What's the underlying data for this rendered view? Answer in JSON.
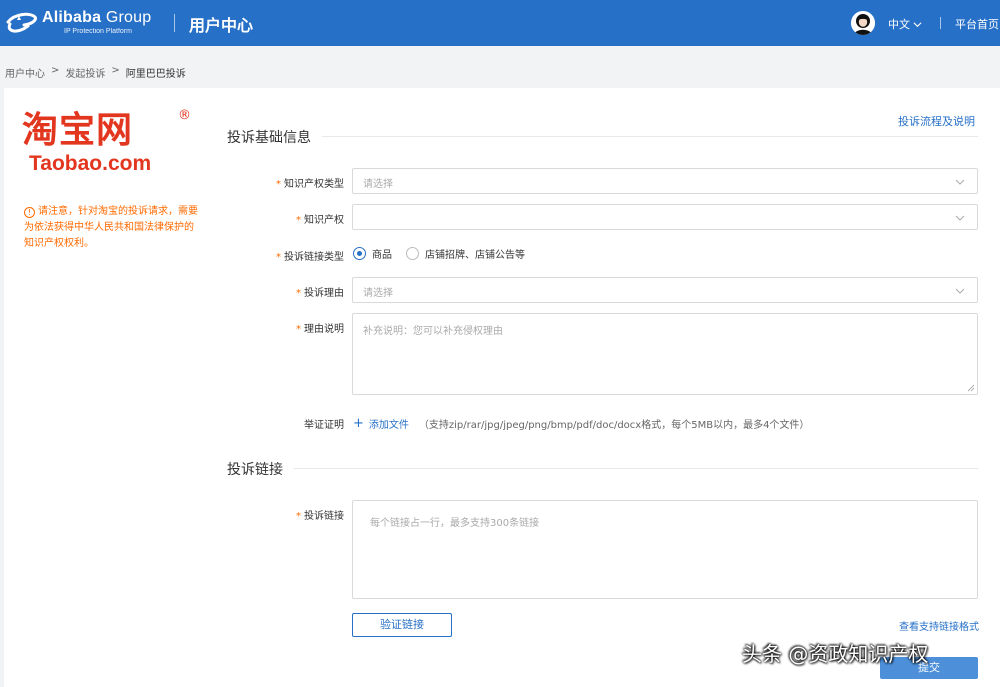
{
  "header": {
    "brand": "Alibaba",
    "brand_group": "Group",
    "brand_sub": "IP Protection Platform",
    "title": "用户中心",
    "language": "中文",
    "home_link": "平台首页",
    "accent_color": "#2770c7"
  },
  "breadcrumb": {
    "items": [
      "用户中心",
      "发起投诉",
      "阿里巴巴投诉"
    ],
    "separator": ">"
  },
  "sidebar": {
    "logo_cn": "淘宝网",
    "logo_reg": "®",
    "logo_en": "Taobao.com",
    "notice_icon": "!",
    "notice": "请注意，针对淘宝的投诉请求，需要为依法获得中华人民共和国法律保护的知识产权权利。",
    "notice_color": "#ff6a00"
  },
  "form": {
    "help_link": "投诉流程及说明",
    "section1_title": "投诉基础信息",
    "ip_type": {
      "label": "知识产权类型",
      "placeholder": "请选择"
    },
    "ip": {
      "label": "知识产权",
      "placeholder": ""
    },
    "link_type": {
      "label": "投诉链接类型",
      "options": [
        "商品",
        "店铺招牌、店铺公告等"
      ],
      "selected": "商品"
    },
    "reason": {
      "label": "投诉理由",
      "placeholder": "请选择"
    },
    "reason_desc": {
      "label": "理由说明",
      "placeholder": "补充说明：您可以补充侵权理由"
    },
    "evidence": {
      "label": "举证证明",
      "add_label": "添加文件",
      "hint": "（支持zip/rar/jpg/jpeg/png/bmp/pdf/doc/docx格式，每个5MB以内，最多4个文件）"
    },
    "section2_title": "投诉链接",
    "links": {
      "label": "投诉链接",
      "placeholder": "每个链接占一行，最多支持300条链接"
    },
    "verify_button": "验证链接",
    "format_link": "查看支持链接格式",
    "submit_button": "提交",
    "required_mark": "*"
  },
  "watermark": "头条 @资政知识产权",
  "icons": {
    "logo": "alibaba-logo-icon",
    "avatar": "user-avatar-icon",
    "dropdown": "chevron-down-icon",
    "plus": "plus-icon",
    "warning": "warning-circle-icon"
  }
}
